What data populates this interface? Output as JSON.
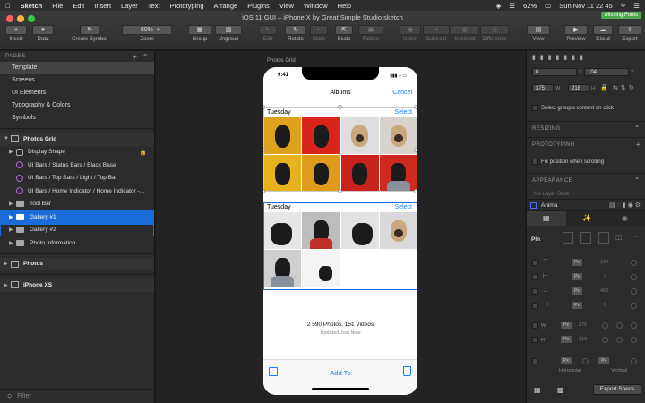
{
  "menubar": {
    "app": "Sketch",
    "items": [
      "File",
      "Edit",
      "Insert",
      "Layer",
      "Text",
      "Prototyping",
      "Arrange",
      "Plugins",
      "View",
      "Window",
      "Help"
    ],
    "battery": "62%",
    "clock": "Sun Nov 11  22 45"
  },
  "window": {
    "title": "iOS 11 GUI – iPhone X by Great Simple Studio.sketch",
    "missing_fonts": "Missing Fonts"
  },
  "toolbar": {
    "insert": "Insert",
    "data": "Data",
    "create_symbol": "Create Symbol",
    "zoom_value": "80%",
    "zoom_label": "Zoom",
    "group": "Group",
    "ungroup": "Ungroup",
    "edit": "Edit",
    "rotate": "Rotate",
    "mask": "Mask",
    "scale": "Scale",
    "flatten": "Flatten",
    "union": "Union",
    "subtract": "Subtract",
    "intersect": "Intersect",
    "difference": "Difference",
    "view": "View",
    "preview": "Preview",
    "cloud": "Cloud",
    "export": "Export"
  },
  "left_panel": {
    "pages_heading": "PAGES",
    "pages": [
      "Template",
      "Screens",
      "UI Elements",
      "Typography & Colors",
      "Symbols"
    ],
    "layers": [
      {
        "label": "Photos Grid",
        "kind": "artboard"
      },
      {
        "label": "Display Shape",
        "kind": "shape"
      },
      {
        "label": "UI Bars / Status Bars / Black Base",
        "kind": "symbol"
      },
      {
        "label": "UI Bars / Top Bars / Light / Top Bar",
        "kind": "symbol"
      },
      {
        "label": "UI Bars / Home Indicator / Home Indicator -...",
        "kind": "symbol"
      },
      {
        "label": "Tool Bar",
        "kind": "folder"
      },
      {
        "label": "Gallery #1",
        "kind": "folder"
      },
      {
        "label": "Gallery #2",
        "kind": "folder"
      },
      {
        "label": "Photo Information",
        "kind": "folder"
      },
      {
        "label": "Photos",
        "kind": "artboard"
      },
      {
        "label": "iPhone XS",
        "kind": "artboard"
      }
    ],
    "filter_placeholder": "Filter"
  },
  "canvas": {
    "artboard_label": "Photos Grid",
    "phone": {
      "time": "9:41",
      "nav_title": "Albums",
      "cancel": "Cancel",
      "gallery1_title": "Tuesday",
      "gallery1_select": "Select",
      "gallery2_title": "Tuesday",
      "gallery2_select": "Select",
      "summary": "2 590 Photos, 151 Videos",
      "updated": "Updated Just Now",
      "add_to": "Add To"
    }
  },
  "inspector": {
    "x": "0",
    "y": "104",
    "w": "375",
    "h": "218",
    "x_label": "X",
    "y_label": "Y",
    "w_label": "W",
    "h_label": "H",
    "select_group": "Select group's content on click",
    "resizing": "RESIZING",
    "prototyping": "PROTOTYPING",
    "fix_position": "Fix position when scrolling",
    "appearance": "APPEARANCE",
    "no_layer_style": "No Layer Style",
    "anima": "Anima",
    "pin": "Pin",
    "px": "Px",
    "pin_values": [
      "104",
      "0",
      "490",
      "0"
    ],
    "size_w_label": "W",
    "size_h_label": "H",
    "size_w": "375",
    "size_h": "218",
    "horizontal": "Horizontal",
    "vertical": "Vertical",
    "export_specs": "Export Specs"
  }
}
